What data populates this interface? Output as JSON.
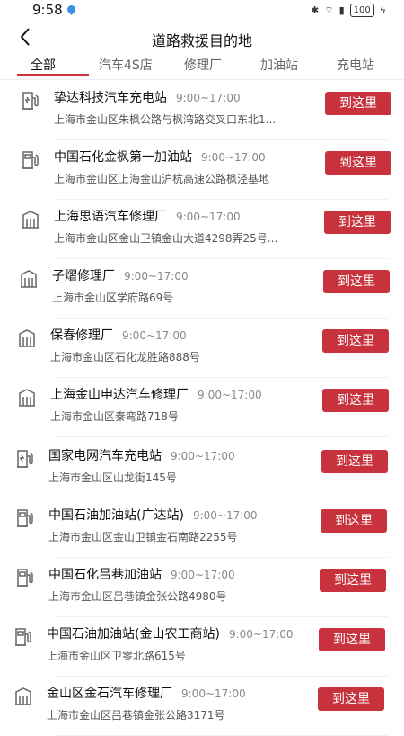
{
  "status": {
    "time": "9:58",
    "battery": "100"
  },
  "header": {
    "title": "道路救援目的地"
  },
  "tabs": [
    "全部",
    "汽车4S店",
    "修理厂",
    "加油站",
    "充电站"
  ],
  "active_tab": "全部",
  "action_label": "到这里",
  "items": [
    {
      "name": "挚达科技汽车充电站",
      "hours": "9:00~17:00",
      "address": "上海市金山区朱枫公路与枫湾路交叉口东北1...",
      "icon": "charging-station-icon"
    },
    {
      "name": "中国石化金枫第一加油站",
      "hours": "9:00~17:00",
      "address": "上海市金山区上海金山沪杭高速公路枫泾基地",
      "icon": "gas-station-icon"
    },
    {
      "name": "上海思语汽车修理厂",
      "hours": "9:00~17:00",
      "address": "上海市金山区金山卫镇金山大道4298弄25号...",
      "icon": "repair-shop-icon"
    },
    {
      "name": "子熠修理厂",
      "hours": "9:00~17:00",
      "address": "上海市金山区学府路69号",
      "icon": "repair-shop-icon"
    },
    {
      "name": "保春修理厂",
      "hours": "9:00~17:00",
      "address": "上海市金山区石化龙胜路888号",
      "icon": "repair-shop-icon"
    },
    {
      "name": "上海金山申达汽车修理厂",
      "hours": "9:00~17:00",
      "address": "上海市金山区秦弯路718号",
      "icon": "repair-shop-icon"
    },
    {
      "name": "国家电网汽车充电站",
      "hours": "9:00~17:00",
      "address": "上海市金山区山龙街145号",
      "icon": "charging-station-icon"
    },
    {
      "name": "中国石油加油站(广达站)",
      "hours": "9:00~17:00",
      "address": "上海市金山区金山卫镇金石南路2255号",
      "icon": "gas-station-icon"
    },
    {
      "name": "中国石化吕巷加油站",
      "hours": "9:00~17:00",
      "address": "上海市金山区吕巷镇金张公路4980号",
      "icon": "gas-station-icon"
    },
    {
      "name": "中国石油加油站(金山农工商站)",
      "hours": "9:00~17:00",
      "address": "上海市金山区卫零北路615号",
      "icon": "gas-station-icon"
    },
    {
      "name": "金山区金石汽车修理厂",
      "hours": "9:00~17:00",
      "address": "上海市金山区吕巷镇金张公路3171号",
      "icon": "repair-shop-icon"
    }
  ],
  "colors": {
    "accent": "#c8323c"
  }
}
